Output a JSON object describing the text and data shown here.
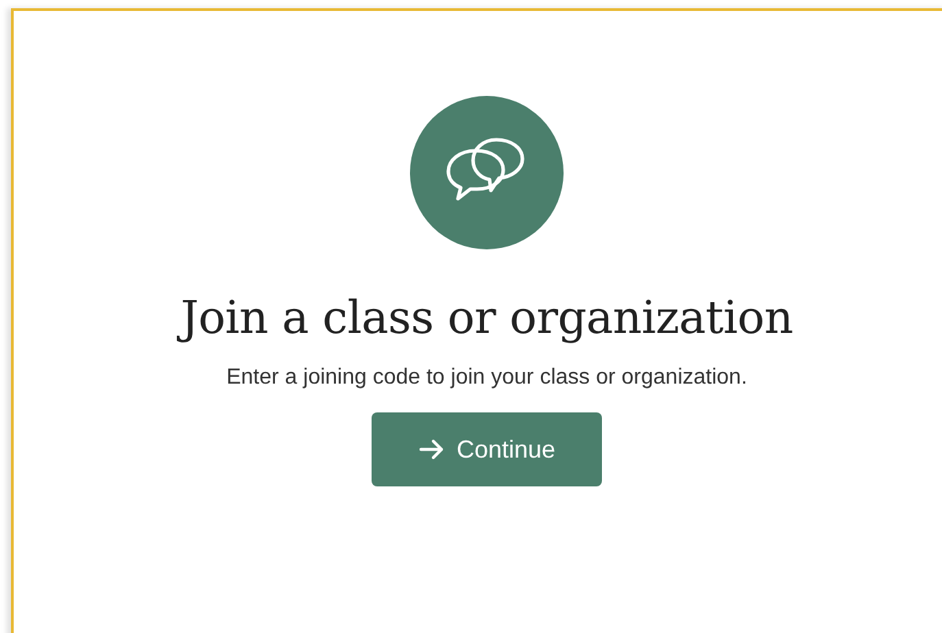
{
  "dialog": {
    "title": "Join a class or organization",
    "message": "Enter a joining code to join your class or organization.",
    "button": {
      "label": "Continue"
    }
  }
}
